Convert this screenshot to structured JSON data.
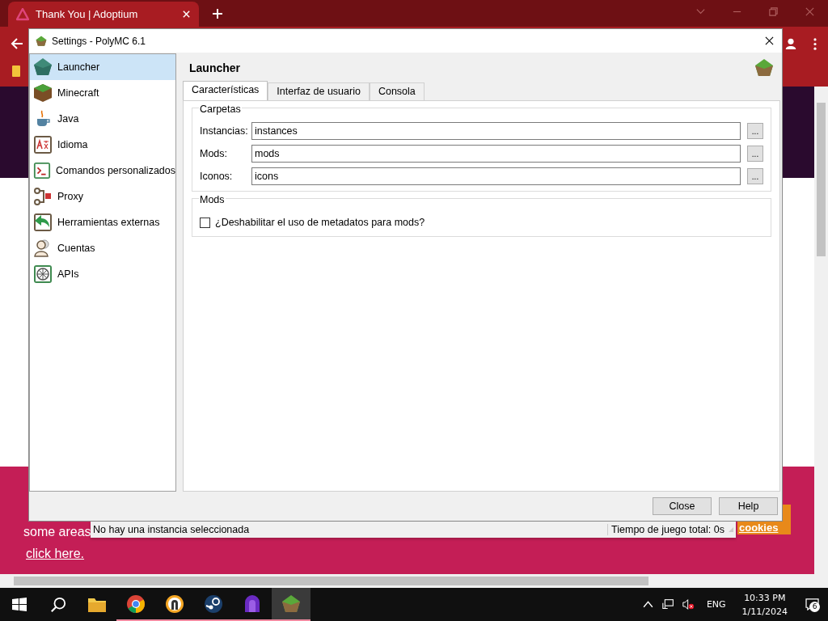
{
  "browser": {
    "tab": {
      "title": "Thank You | Adoptium"
    },
    "page": {
      "lines": [
        "some areas"
      ],
      "link": "click here.",
      "button": "cookies"
    }
  },
  "dialog": {
    "title": "Settings - PolyMC 6.1",
    "sidebar": {
      "items": [
        {
          "label": "Launcher",
          "kind": "launcher",
          "selected": true
        },
        {
          "label": "Minecraft",
          "kind": "grass",
          "selected": false
        },
        {
          "label": "Java",
          "kind": "java",
          "selected": false
        },
        {
          "label": "Idioma",
          "kind": "language",
          "selected": false
        },
        {
          "label": "Comandos personalizados",
          "kind": "terminal",
          "selected": false
        },
        {
          "label": "Proxy",
          "kind": "proxy",
          "selected": false
        },
        {
          "label": "Herramientas externas",
          "kind": "tools",
          "selected": false
        },
        {
          "label": "Cuentas",
          "kind": "accounts",
          "selected": false
        },
        {
          "label": "APIs",
          "kind": "apis",
          "selected": false
        }
      ]
    },
    "page_title": "Launcher",
    "tabs": [
      {
        "label": "Características",
        "selected": true
      },
      {
        "label": "Interfaz de usuario",
        "selected": false
      },
      {
        "label": "Consola",
        "selected": false
      }
    ],
    "folders": {
      "title": "Carpetas",
      "fields": [
        {
          "label": "Instancias:",
          "value": "instances",
          "browse": "..."
        },
        {
          "label": "Mods:",
          "value": "mods",
          "browse": "..."
        },
        {
          "label": "Iconos:",
          "value": "icons",
          "browse": "..."
        }
      ]
    },
    "mods": {
      "title": "Mods",
      "checkbox": {
        "label": "¿Deshabilitar el uso de metadatos para mods?",
        "checked": false
      }
    },
    "buttons": [
      "Close",
      "Help"
    ],
    "status_bar": {
      "left": "No hay una instancia seleccionada",
      "right": "Tiempo de juego total: 0s"
    }
  },
  "taskbar": {
    "apps": [
      {
        "kind": "folder",
        "running": false,
        "active": false
      },
      {
        "kind": "chrome",
        "running": true,
        "active": false
      },
      {
        "kind": "keyhole",
        "running": true,
        "active": false
      },
      {
        "kind": "steam",
        "running": true,
        "active": false
      },
      {
        "kind": "purple",
        "running": true,
        "active": false
      },
      {
        "kind": "polymc",
        "running": true,
        "active": true
      }
    ],
    "language": "ENG",
    "time": "10:33 PM",
    "date": "1/11/2024",
    "notifications": "6"
  }
}
